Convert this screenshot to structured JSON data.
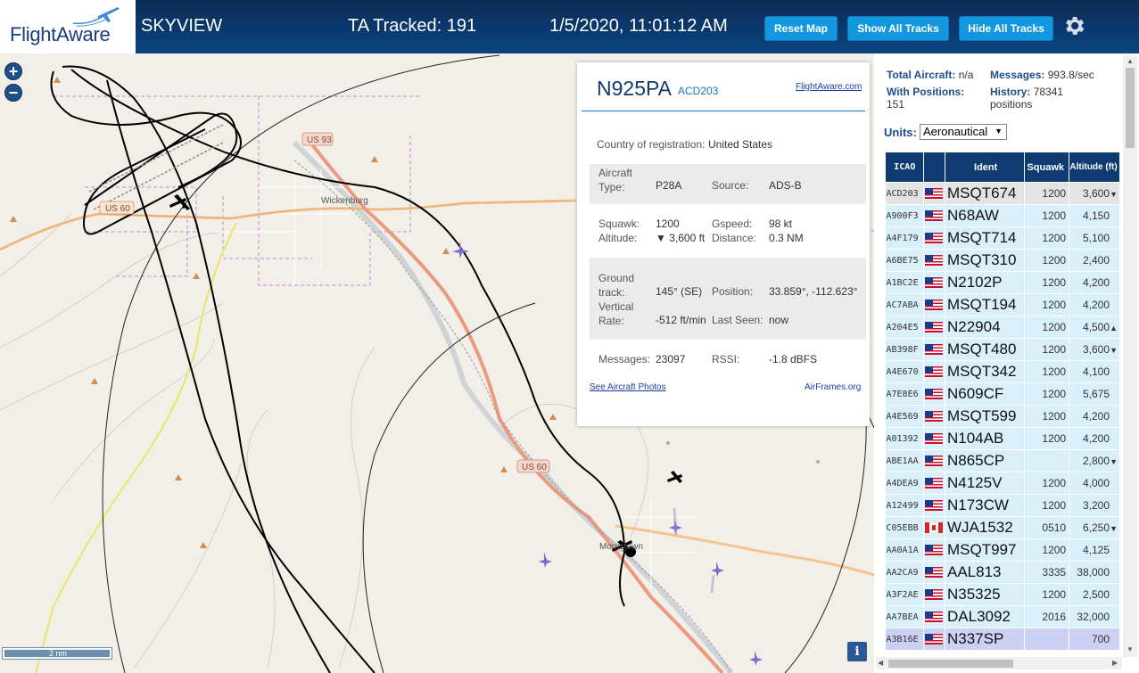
{
  "header": {
    "logo_text": "FlightAware",
    "app_name": "SKYVIEW",
    "tracked": "TA Tracked: 191",
    "datetime": "1/5/2020, 11:01:12 AM",
    "buttons": {
      "reset_map": "Reset Map",
      "show_tracks": "Show All Tracks",
      "hide_tracks": "Hide All Tracks"
    },
    "settings_icon": "gear-icon"
  },
  "map": {
    "zoom_in": "+",
    "zoom_out": "−",
    "scale": "2 nm",
    "info": "i",
    "labels": {
      "town1": "Wickenburg",
      "town2": "Morristown",
      "hwy_us60_a": "US 60",
      "hwy_us93": "US 93",
      "hwy_us60_b": "US 60"
    }
  },
  "popup": {
    "callsign": "N925PA",
    "icao": "ACD203",
    "fa_link": "FlightAware.com",
    "country_label": "Country of registration:",
    "country": "United States",
    "aircraft_type_label": "Aircraft Type:",
    "aircraft_type": "P28A",
    "source_label": "Source:",
    "source": "ADS-B",
    "squawk_label": "Squawk:",
    "squawk": "1200",
    "gspeed_label": "Gspeed:",
    "gspeed": "98 kt",
    "altitude_label": "Altitude:",
    "altitude": "▼ 3,600 ft",
    "distance_label": "Distance:",
    "distance": "0.3 NM",
    "ground_track_label": "Ground track:",
    "ground_track": "145° (SE)",
    "position_label": "Position:",
    "position": "33.859°, -112.623°",
    "vrate_label": "Vertical Rate:",
    "vrate": "-512 ft/min",
    "last_seen_label": "Last Seen:",
    "last_seen": "now",
    "messages_label": "Messages:",
    "messages": "23097",
    "rssi_label": "RSSI:",
    "rssi": "-1.8 dBFS",
    "photos_link": "See Aircraft Photos",
    "airframes": "AirFrames.org"
  },
  "sidebar": {
    "total_aircraft_label": "Total Aircraft:",
    "total_aircraft": "n/a",
    "messages_label": "Messages:",
    "messages": "993.8/sec",
    "with_positions_label": "With Positions:",
    "with_positions": "151",
    "history_label": "History:",
    "history": "78341 positions",
    "units_label": "Units:",
    "units_value": "Aeronautical",
    "columns": [
      "ICAO",
      "",
      "Ident",
      "Squawk",
      "Altitude (ft)"
    ],
    "rows": [
      {
        "icao": "ACD203",
        "flag": "us",
        "ident": "MSQT674",
        "squawk": "1200",
        "alt": "3,600",
        "trend": "▼",
        "state": "sel"
      },
      {
        "icao": "A900F3",
        "flag": "us",
        "ident": "N68AW",
        "squawk": "1200",
        "alt": "4,150",
        "trend": "",
        "state": ""
      },
      {
        "icao": "A4F179",
        "flag": "us",
        "ident": "MSQT714",
        "squawk": "1200",
        "alt": "5,100",
        "trend": "",
        "state": ""
      },
      {
        "icao": "A6BE75",
        "flag": "us",
        "ident": "MSQT310",
        "squawk": "1200",
        "alt": "2,400",
        "trend": "",
        "state": ""
      },
      {
        "icao": "A1BC2E",
        "flag": "us",
        "ident": "N2102P",
        "squawk": "1200",
        "alt": "4,200",
        "trend": "",
        "state": ""
      },
      {
        "icao": "AC7ABA",
        "flag": "us",
        "ident": "MSQT194",
        "squawk": "1200",
        "alt": "4,200",
        "trend": "",
        "state": ""
      },
      {
        "icao": "A204E5",
        "flag": "us",
        "ident": "N22904",
        "squawk": "1200",
        "alt": "4,500",
        "trend": "▲",
        "state": ""
      },
      {
        "icao": "AB398F",
        "flag": "us",
        "ident": "MSQT480",
        "squawk": "1200",
        "alt": "3,600",
        "trend": "▼",
        "state": ""
      },
      {
        "icao": "A4E670",
        "flag": "us",
        "ident": "MSQT342",
        "squawk": "1200",
        "alt": "4,100",
        "trend": "",
        "state": ""
      },
      {
        "icao": "A7E8E6",
        "flag": "us",
        "ident": "N609CF",
        "squawk": "1200",
        "alt": "5,675",
        "trend": "",
        "state": ""
      },
      {
        "icao": "A4E569",
        "flag": "us",
        "ident": "MSQT599",
        "squawk": "1200",
        "alt": "4,200",
        "trend": "",
        "state": ""
      },
      {
        "icao": "A01392",
        "flag": "us",
        "ident": "N104AB",
        "squawk": "1200",
        "alt": "4,200",
        "trend": "",
        "state": ""
      },
      {
        "icao": "ABE1AA",
        "flag": "us",
        "ident": "N865CP",
        "squawk": "",
        "alt": "2,800",
        "trend": "▼",
        "state": ""
      },
      {
        "icao": "A4DEA9",
        "flag": "us",
        "ident": "N4125V",
        "squawk": "1200",
        "alt": "4,000",
        "trend": "",
        "state": ""
      },
      {
        "icao": "A12499",
        "flag": "us",
        "ident": "N173CW",
        "squawk": "1200",
        "alt": "3,200",
        "trend": "",
        "state": ""
      },
      {
        "icao": "C05EBB",
        "flag": "ca",
        "ident": "WJA1532",
        "squawk": "0510",
        "alt": "6,250",
        "trend": "▼",
        "state": ""
      },
      {
        "icao": "AA0A1A",
        "flag": "us",
        "ident": "MSQT997",
        "squawk": "1200",
        "alt": "4,125",
        "trend": "",
        "state": ""
      },
      {
        "icao": "AA2CA9",
        "flag": "us",
        "ident": "AAL813",
        "squawk": "3335",
        "alt": "38,000",
        "trend": "",
        "state": ""
      },
      {
        "icao": "A3F2AE",
        "flag": "us",
        "ident": "N35325",
        "squawk": "1200",
        "alt": "2,500",
        "trend": "",
        "state": ""
      },
      {
        "icao": "AA7BEA",
        "flag": "us",
        "ident": "DAL3092",
        "squawk": "2016",
        "alt": "32,000",
        "trend": "",
        "state": ""
      },
      {
        "icao": "A3B16E",
        "flag": "us",
        "ident": "N337SP",
        "squawk": "",
        "alt": "700",
        "trend": "",
        "state": "hl"
      }
    ]
  },
  "colors": {
    "header_bg": "#0c2c55",
    "button": "#1398e0",
    "table_header": "#0e3c72",
    "row_bg": "#d9eff9",
    "map_bg": "#f2efe9",
    "highway": "#e8947a"
  }
}
